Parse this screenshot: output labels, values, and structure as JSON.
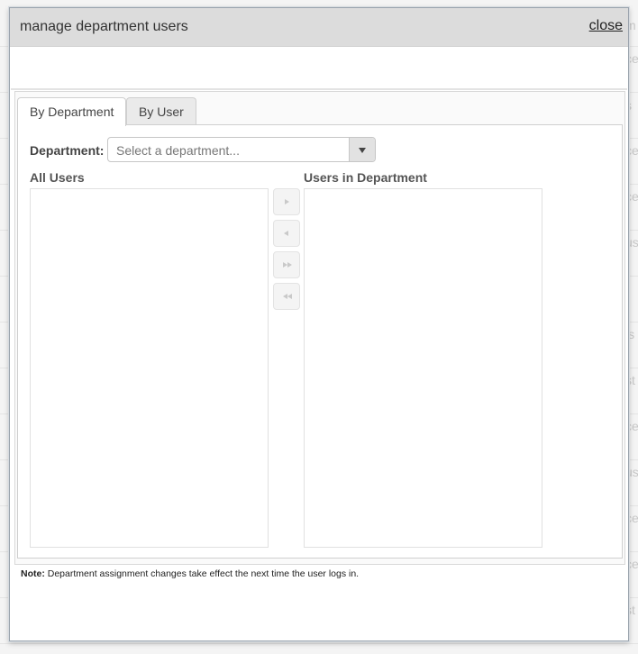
{
  "background": {
    "fragments": [
      "m",
      "ce",
      "s",
      "ce",
      "ce",
      "us",
      "f",
      "is",
      "st",
      "ce",
      "us",
      "ce",
      "ce",
      "st"
    ]
  },
  "dialog": {
    "title": "manage department users",
    "close_label": "close"
  },
  "tabs": [
    {
      "label": "By Department",
      "active": true
    },
    {
      "label": "By User",
      "active": false
    }
  ],
  "department": {
    "label": "Department:",
    "placeholder": "Select a department..."
  },
  "lists": {
    "all_users_label": "All Users",
    "users_in_department_label": "Users in Department",
    "all_users": [],
    "users_in_department": []
  },
  "move_buttons": [
    {
      "name": "move-right-button",
      "icon": "triangle-right-icon"
    },
    {
      "name": "move-left-button",
      "icon": "triangle-left-icon"
    },
    {
      "name": "move-all-right-button",
      "icon": "double-triangle-right-icon"
    },
    {
      "name": "move-all-left-button",
      "icon": "double-triangle-left-icon"
    }
  ],
  "note": {
    "prefix": "Note:",
    "text": " Department assignment changes take effect the next time the user logs in."
  },
  "colors": {
    "header_bg": "#dcdcdc",
    "dialog_border": "#9aa3ad",
    "panel_bg": "#fafafa"
  }
}
